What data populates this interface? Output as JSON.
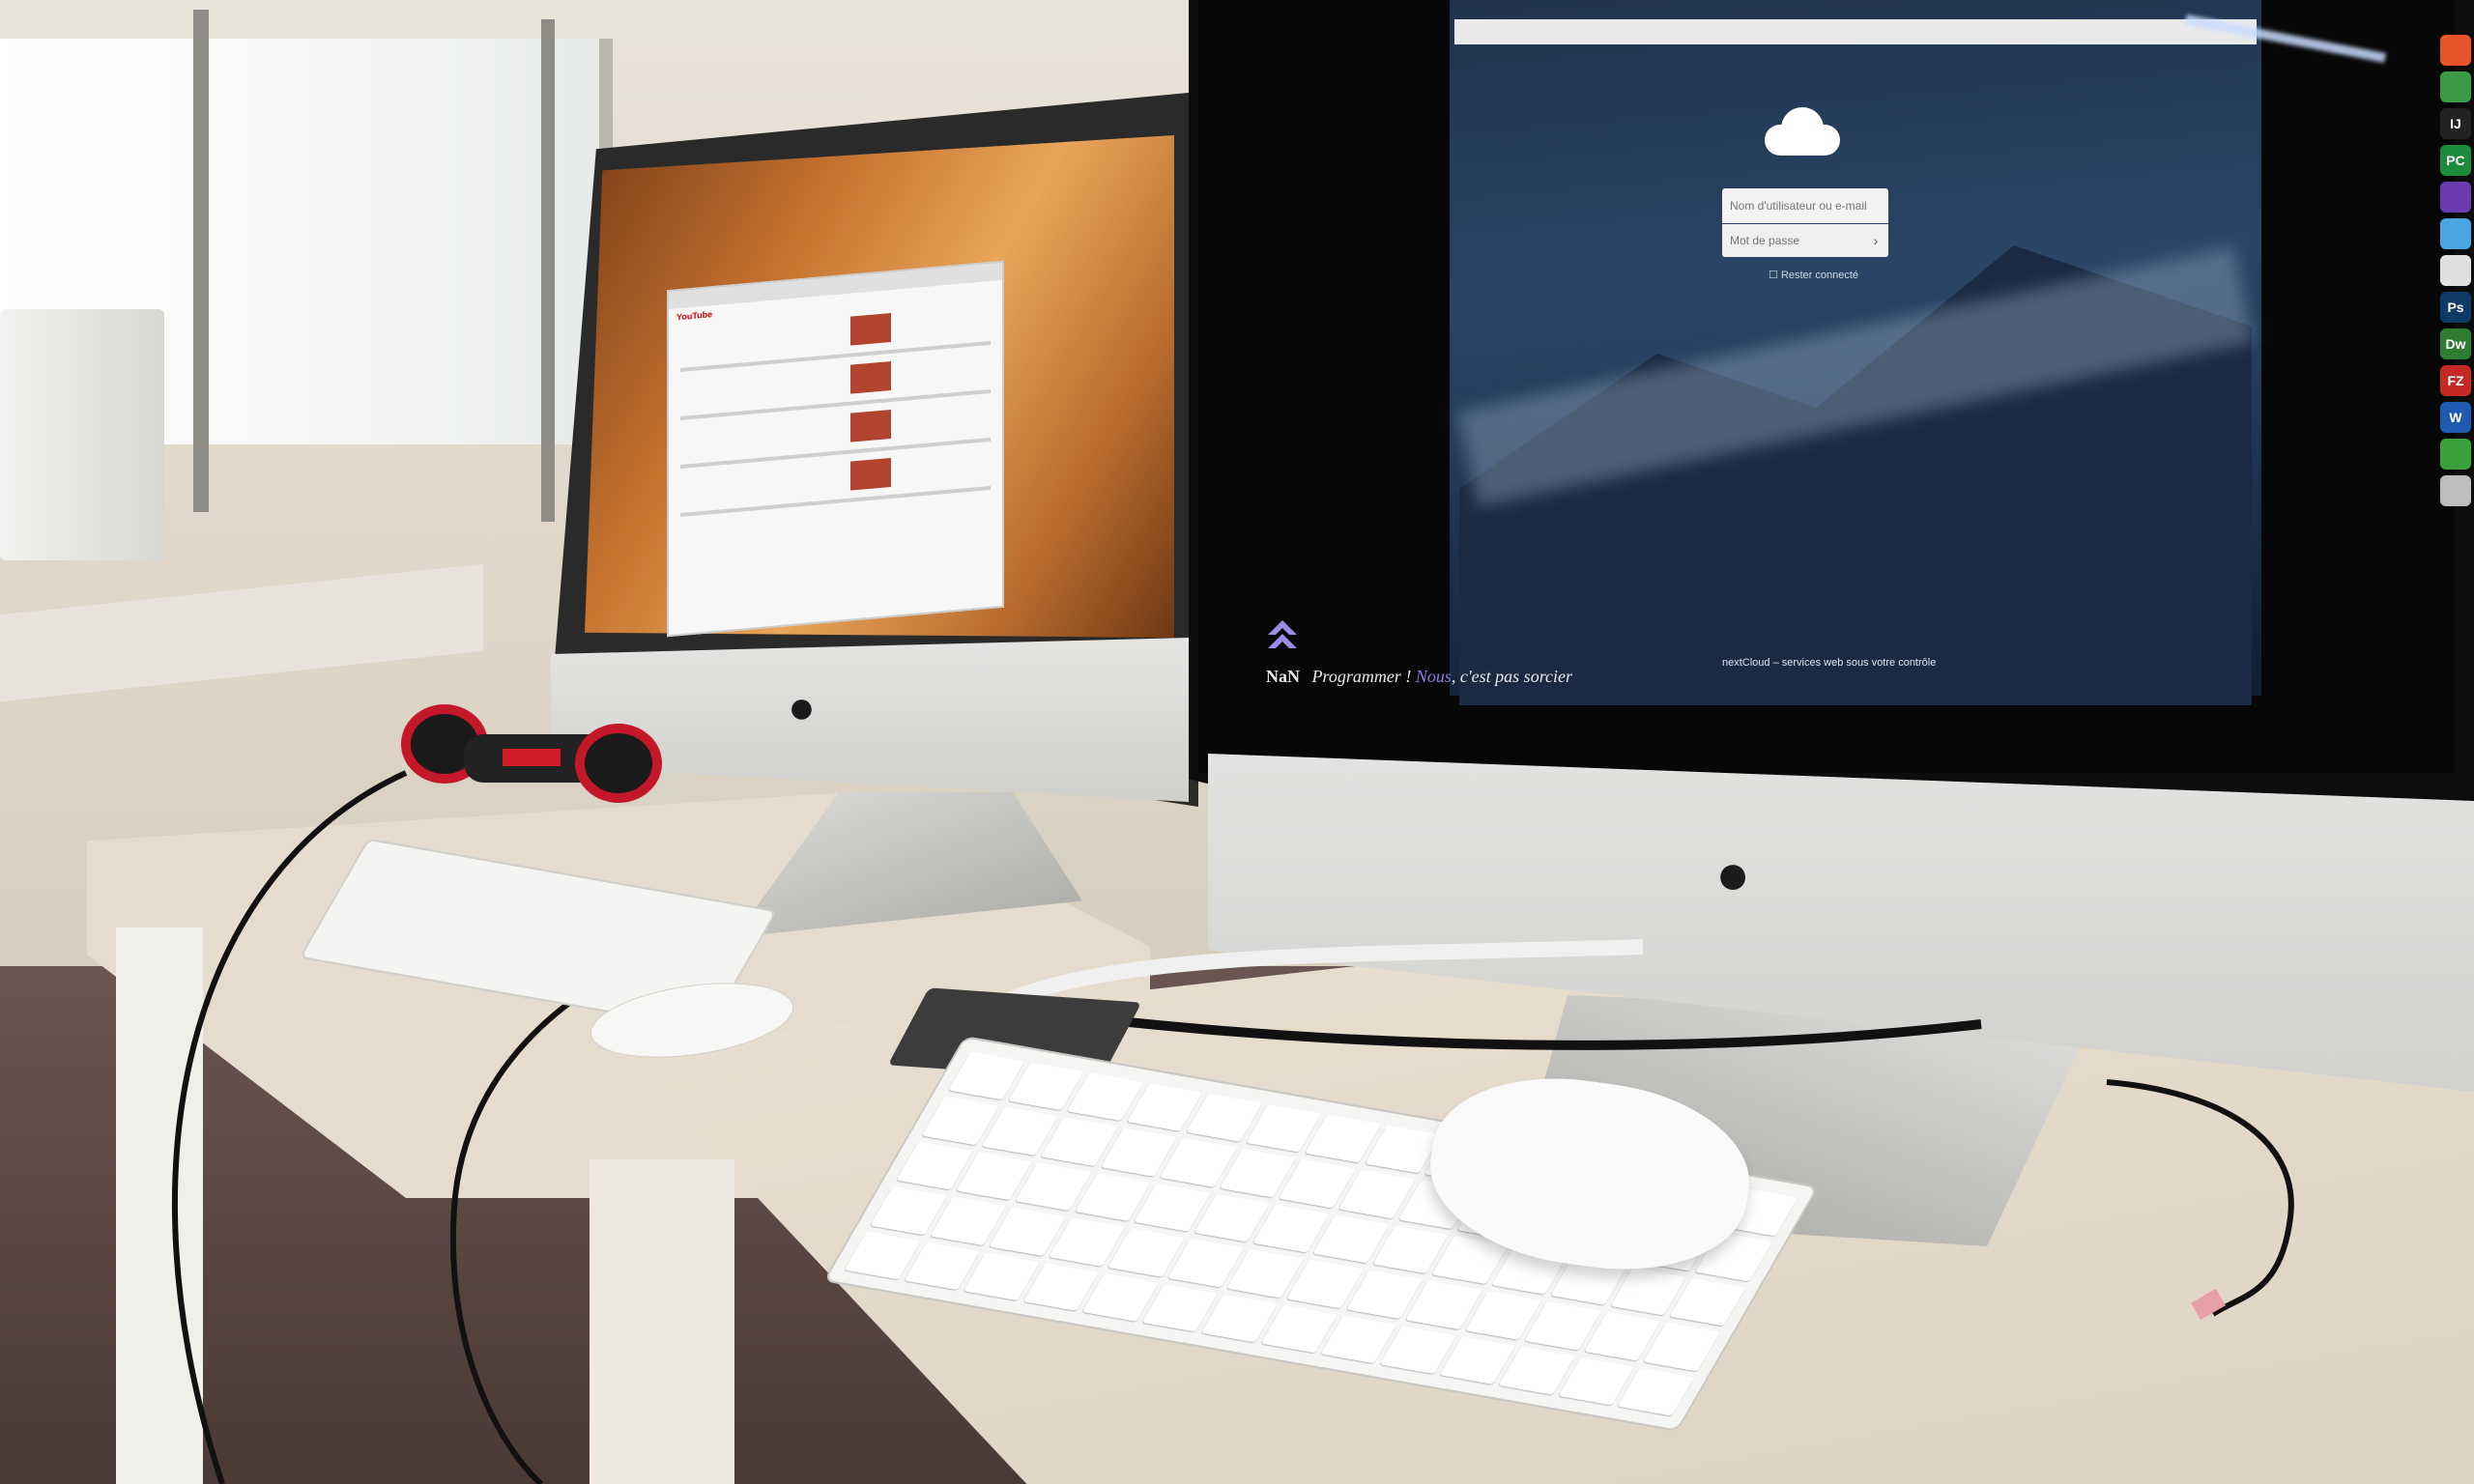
{
  "scene": {
    "description_label": "Office desk with two iMac computers"
  },
  "left_imac": {
    "browser_url": "",
    "site_logo": "YouTube"
  },
  "right_imac": {
    "browser_url": "",
    "nextcloud": {
      "username_placeholder": "Nom d'utilisateur ou e-mail",
      "password_placeholder": "Mot de passe",
      "remember_label": "Rester connecté",
      "footer_text": "nextCloud – services web sous votre contrôle"
    },
    "wallpaper_brand": {
      "logo_text": "NaN",
      "slogan_prefix": "Programmer ! ",
      "slogan_accent": "Nous",
      "slogan_suffix": ", c'est pas sorcier"
    },
    "dock_icons": [
      {
        "name": "firefox-icon",
        "label": "",
        "color": "#e8542a"
      },
      {
        "name": "chrome-icon",
        "label": "",
        "color": "#3b9a45"
      },
      {
        "name": "intellij-icon",
        "label": "IJ",
        "color": "#222222"
      },
      {
        "name": "pycharm-icon",
        "label": "PC",
        "color": "#1e8a3c"
      },
      {
        "name": "visual-studio-icon",
        "label": "",
        "color": "#6a3cb0"
      },
      {
        "name": "folder-icon",
        "label": "",
        "color": "#4aa6e0"
      },
      {
        "name": "finder-icon",
        "label": "",
        "color": "#e0e0e0"
      },
      {
        "name": "photoshop-icon",
        "label": "Ps",
        "color": "#0f3a66"
      },
      {
        "name": "dreamweaver-icon",
        "label": "Dw",
        "color": "#2e7d32"
      },
      {
        "name": "filezilla-icon",
        "label": "FZ",
        "color": "#c62828"
      },
      {
        "name": "word-icon",
        "label": "W",
        "color": "#1e5bb0"
      },
      {
        "name": "utorrent-icon",
        "label": "",
        "color": "#3aa03a"
      },
      {
        "name": "trash-icon",
        "label": "",
        "color": "#bdbdbd"
      }
    ]
  },
  "colors": {
    "desk": "#e6dccd",
    "nextcloud_blue": "#2b4567",
    "lion_orange": "#c4712e"
  }
}
